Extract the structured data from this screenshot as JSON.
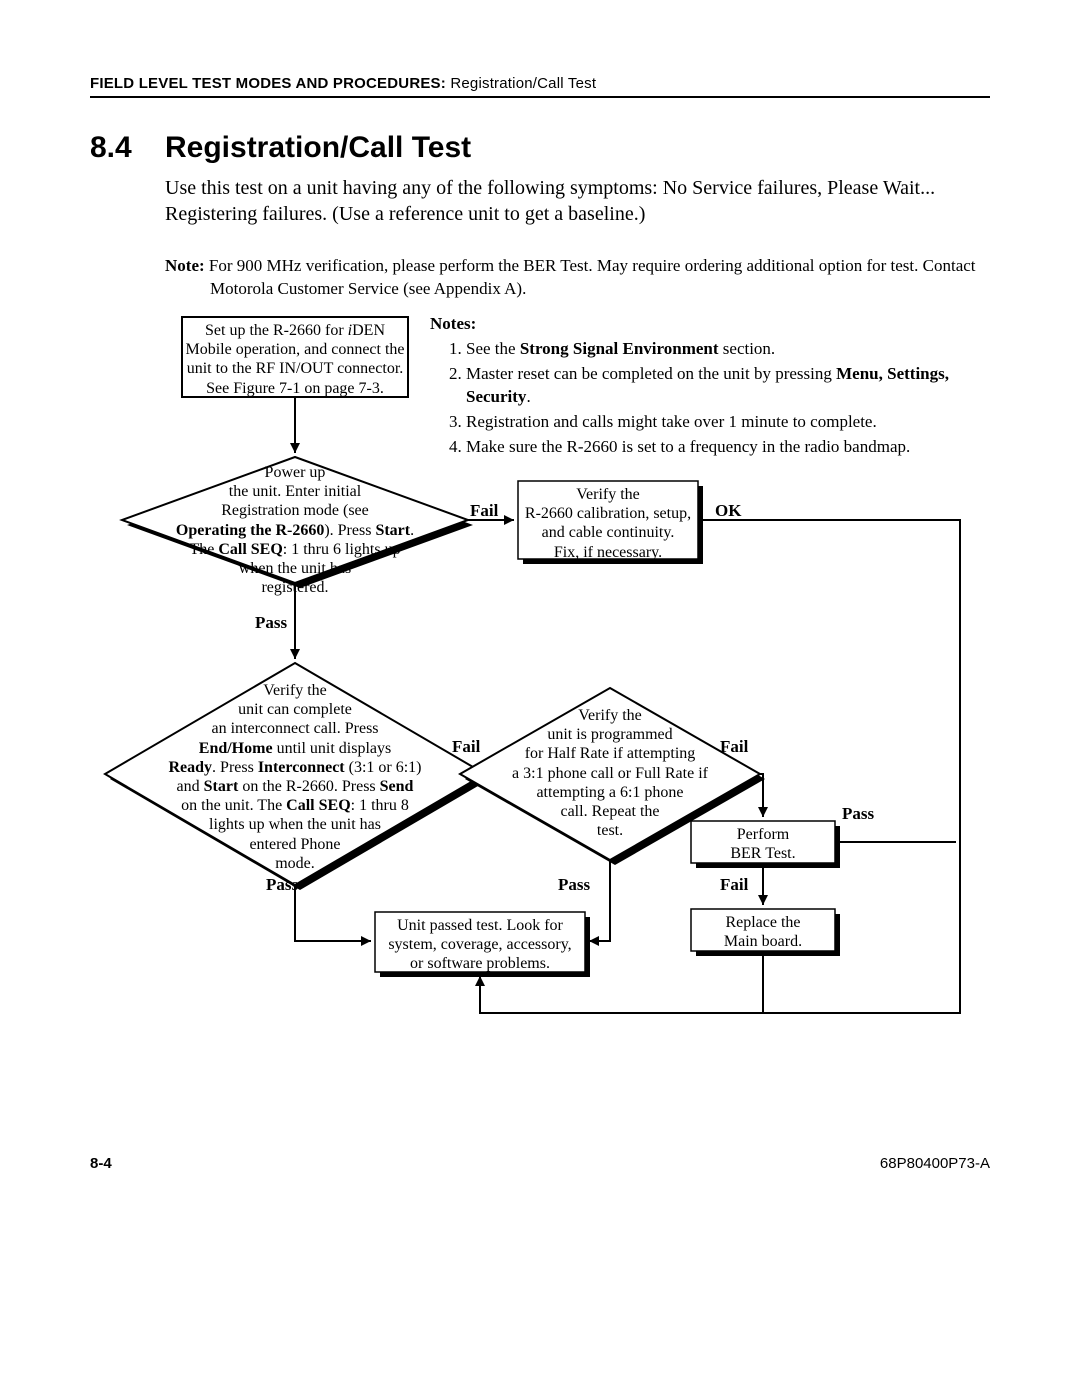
{
  "header": {
    "prefix": "FIELD LEVEL TEST MODES AND PROCEDURES:  ",
    "suffix": "Registration/Call Test"
  },
  "section": {
    "number": "8.4",
    "title": "Registration/Call Test",
    "body": "Use this test on a unit having any of the following symptoms: No Service failures, Please Wait... Registering failures. (Use a reference unit to get a baseline.)"
  },
  "top_note": {
    "label": "Note:",
    "text": "For 900 MHz verification, please perform the BER Test. May require ordering additional option for test. Contact Motorola Customer Service (see Appendix A)."
  },
  "flow": {
    "setup_box_l1": "Set up the R-2660 for ",
    "setup_box_l1_em": "i",
    "setup_box_l1_tail": "DEN",
    "setup_box_l2": "Mobile operation, and connect the",
    "setup_box_l3": "unit to the RF IN/OUT connector.",
    "setup_box_l4": "See Figure 7-1 on page 7-3.",
    "d1_l1": "Power up",
    "d1_l2": "the unit. Enter initial",
    "d1_l3": "Registration mode (see",
    "d1_l4a": "Operating the R-2660",
    "d1_l4b": "). Press ",
    "d1_l4c": "Start",
    "d1_l4d": ".",
    "d1_l5a": "The ",
    "d1_l5b": "Call SEQ",
    "d1_l5c": ": 1 thru 6 lights up",
    "d1_l6": "when the unit has",
    "d1_l7": "registered.",
    "verify_cal_l1": "Verify the",
    "verify_cal_l2": "R-2660 calibration, setup,",
    "verify_cal_l3": "and cable continuity.",
    "verify_cal_l4": "Fix, if necessary.",
    "d2_l1": "Verify the",
    "d2_l2": "unit can complete",
    "d2_l3": "an interconnect call. Press",
    "d2_l4a": "End/Home",
    "d2_l4b": " until unit displays",
    "d2_l5a": "Ready",
    "d2_l5b": ". Press ",
    "d2_l5c": "Interconnect",
    "d2_l5d": " (3:1 or 6:1)",
    "d2_l6a": "and ",
    "d2_l6b": "Start",
    "d2_l6c": " on the R-2660. Press ",
    "d2_l6d": "Send",
    "d2_l7a": "on the unit. The ",
    "d2_l7b": "Call SEQ",
    "d2_l7c": ": 1 thru 8",
    "d2_l8": "lights up when the unit has",
    "d2_l9": "entered Phone",
    "d2_l10": "mode.",
    "d3_l1": "Verify the",
    "d3_l2": "unit is programmed",
    "d3_l3": "for Half Rate if attempting",
    "d3_l4": "a 3:1 phone call or Full Rate if",
    "d3_l5": "attempting a 6:1 phone",
    "d3_l6": "call. Repeat the",
    "d3_l7": "test.",
    "result_l1": "Unit passed test. Look for",
    "result_l2": "system, coverage, accessory,",
    "result_l3": "or software problems.",
    "ber_l1": "Perform",
    "ber_l2": "BER Test.",
    "replace_l1": "Replace the",
    "replace_l2": "Main board.",
    "labels": {
      "fail": "Fail",
      "pass": "Pass",
      "ok": "OK"
    }
  },
  "notes": {
    "heading": "Notes:",
    "i1a": "See the ",
    "i1b": "Strong Signal Environment",
    "i1c": " section.",
    "i2a": "Master reset can be completed on the unit by pressing ",
    "i2b": "Menu, Settings, Security",
    "i2c": ".",
    "i3": "Registration and calls might take over 1 minute to complete.",
    "i4": "Make sure the R-2660 is set to a frequency in the radio bandmap."
  },
  "footer": {
    "left": "8-4",
    "right": "68P80400P73-A"
  }
}
